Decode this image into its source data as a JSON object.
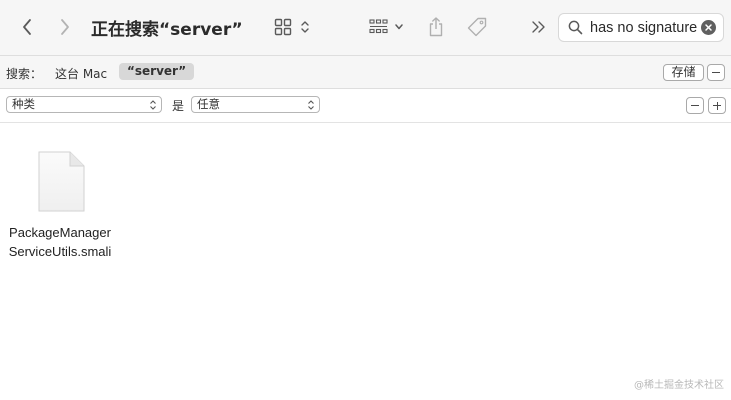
{
  "window": {
    "title": "正在搜索“server”"
  },
  "search": {
    "value": "has no signature"
  },
  "scope": {
    "label": "搜索：",
    "this_mac": "这台 Mac",
    "active_scope": "“server”",
    "save_label": "存储"
  },
  "criteria": {
    "attribute": "种类",
    "operator": "是",
    "value": "任意"
  },
  "results": [
    {
      "name_line1": "PackageManager",
      "name_line2": "ServiceUtils.smali",
      "icon": "document-icon"
    }
  ],
  "watermark": "@稀土掘金技术社区"
}
